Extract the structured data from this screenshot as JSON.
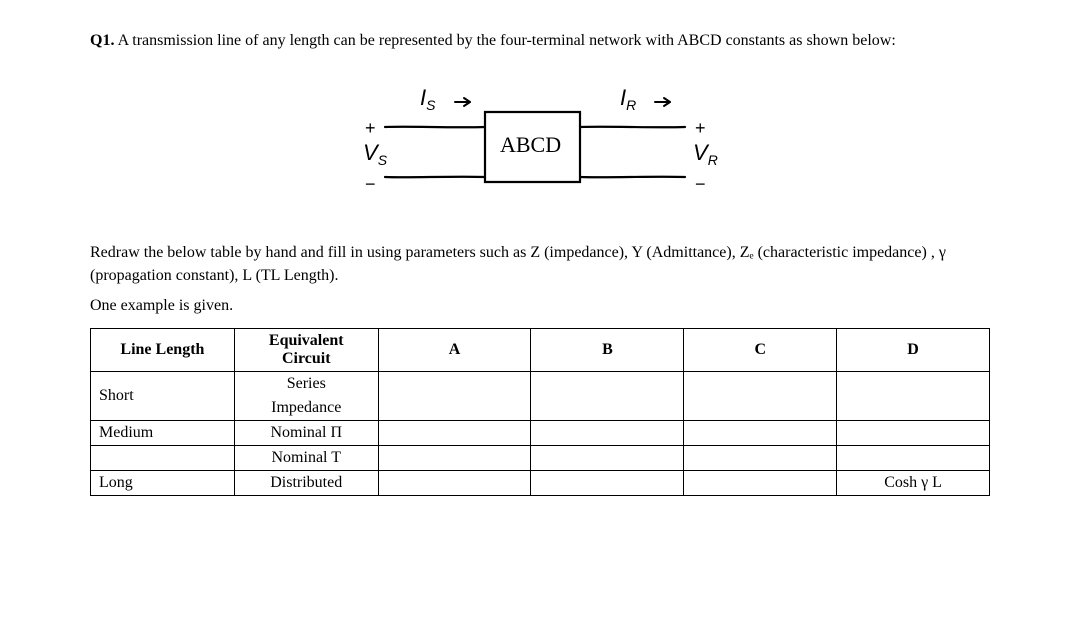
{
  "question": {
    "number": "Q1.",
    "text": "A transmission line of any length can be represented by the four-terminal network with ABCD constants as shown below:"
  },
  "diagram": {
    "is_label": "I",
    "is_sub": "S",
    "ir_label": "I",
    "ir_sub": "R",
    "vs_label": "V",
    "vs_sub": "S",
    "vr_label": "V",
    "vr_sub": "R",
    "box_label": "ABCD",
    "plus": "+",
    "minus": "−",
    "arrow": "→"
  },
  "instructions": {
    "p1": "Redraw the below table by hand and fill in using parameters such as Z (impedance), Y (Admittance), Zₑ (characteristic impedance) , γ (propagation constant), L (TL Length).",
    "p2": "One example is given."
  },
  "table": {
    "headers": {
      "line_length": "Line Length",
      "equiv_circuit": "Equivalent Circuit",
      "a": "A",
      "b": "B",
      "c": "C",
      "d": "D"
    },
    "rows": [
      {
        "length": "Short",
        "circuit": "Series Impedance",
        "a": "",
        "b": "",
        "c": "",
        "d": ""
      },
      {
        "length": "Medium",
        "circuit": "Nominal Π",
        "a": "",
        "b": "",
        "c": "",
        "d": ""
      },
      {
        "length": "",
        "circuit": "Nominal T",
        "a": "",
        "b": "",
        "c": "",
        "d": ""
      },
      {
        "length": "Long",
        "circuit": "Distributed",
        "a": "",
        "b": "",
        "c": "",
        "d": "Cosh γ L"
      }
    ]
  }
}
